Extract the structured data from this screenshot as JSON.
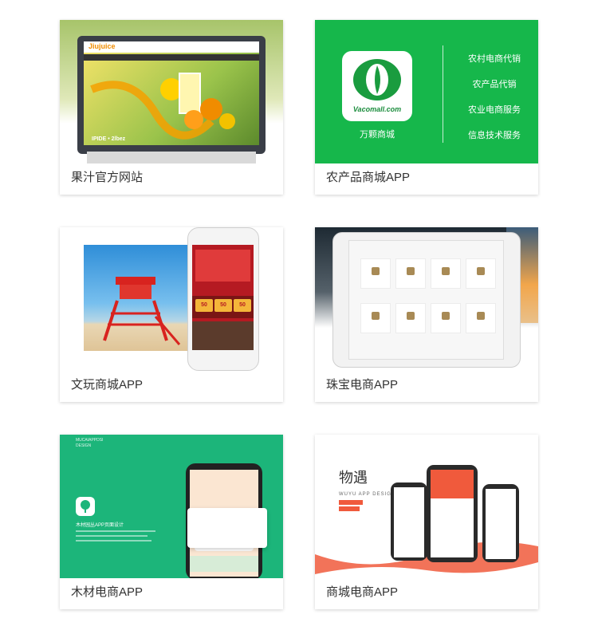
{
  "cards": [
    {
      "caption": "果汁官方网站",
      "brand": "Jiujuice",
      "banner_text": "IPIDE • 2lbez"
    },
    {
      "caption": "农产品商城APP",
      "logo_text": "Vacomall.com",
      "subtitle": "万颗商城",
      "services": [
        "农村电商代销",
        "农产品代销",
        "农业电商服务",
        "信息技术服务"
      ]
    },
    {
      "caption": "文玩商城APP",
      "coupons": [
        "50",
        "50",
        "50"
      ]
    },
    {
      "caption": "珠宝电商APP"
    },
    {
      "caption": "木材电商APP",
      "header_line1": "MUCAIAPPDSI",
      "header_line2": "DESIGN",
      "app_name": "木材园丛APP页面设计"
    },
    {
      "caption": "商城电商APP",
      "title": "物遇",
      "subtitle": "WUYU APP DESIGN"
    }
  ],
  "colors": {
    "green_brand": "#16b74b",
    "teal_brand": "#1cb57a",
    "caption_text": "#333333"
  }
}
